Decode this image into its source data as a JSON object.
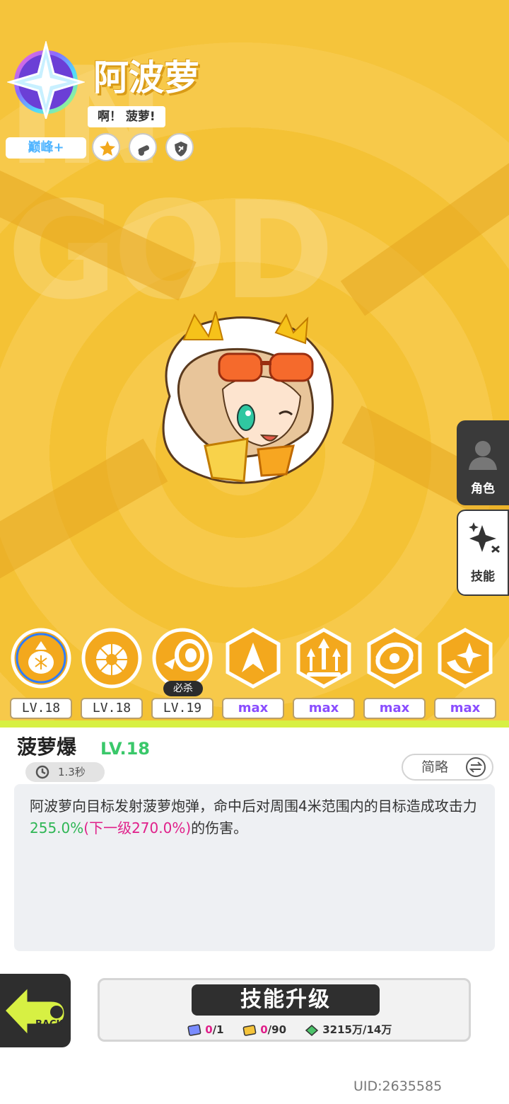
{
  "character": {
    "name": "阿波萝",
    "quote": "啊！ 菠萝!",
    "rank": "巅峰+"
  },
  "watermark": "IN GOD",
  "traits": [
    {
      "icon": "burst-icon"
    },
    {
      "icon": "cannon-icon"
    },
    {
      "icon": "shield-icon"
    }
  ],
  "side_tabs": [
    {
      "label": "角色",
      "icon": "character-icon",
      "active": false
    },
    {
      "label": "技能",
      "icon": "sparkle-icon",
      "active": true
    }
  ],
  "skills": [
    {
      "icon": "pineapple-bomb-icon",
      "level": "LV.18",
      "selected": true
    },
    {
      "icon": "pineapple-slice-icon",
      "level": "LV.18"
    },
    {
      "icon": "blast-icon",
      "level": "LV.19",
      "badge": "必杀"
    },
    {
      "icon": "up-slash-icon",
      "level": "max"
    },
    {
      "icon": "triple-arrow-icon",
      "level": "max"
    },
    {
      "icon": "swirl-icon",
      "level": "max"
    },
    {
      "icon": "crescent-star-icon",
      "level": "max"
    }
  ],
  "selected_skill": {
    "name": "菠萝爆",
    "level": "LV.18",
    "cooldown": "1.3秒",
    "mode_toggle": "简略",
    "desc_before": "阿波萝向目标发射菠萝炮弹，命中后对周围4米范围内的目标造成攻击力",
    "desc_current": "255.0%",
    "desc_next": "(下一级270.0%)",
    "desc_after": "的伤害。"
  },
  "upgrade": {
    "label": "技能升级",
    "costs": [
      {
        "icon": "skill-book-icon",
        "have": "0",
        "need": "/1"
      },
      {
        "icon": "ticket-icon",
        "have": "0",
        "need": "/90"
      },
      {
        "icon": "money-icon",
        "have": "3215万",
        "need": "/14万"
      }
    ]
  },
  "back_label": "BACK",
  "uid": "UID:2635585",
  "colors": {
    "bg_yellow": "#f5c43b",
    "accent_green": "#3ac86a",
    "accent_pink": "#e0208a",
    "max_purple": "#8a4dff"
  }
}
